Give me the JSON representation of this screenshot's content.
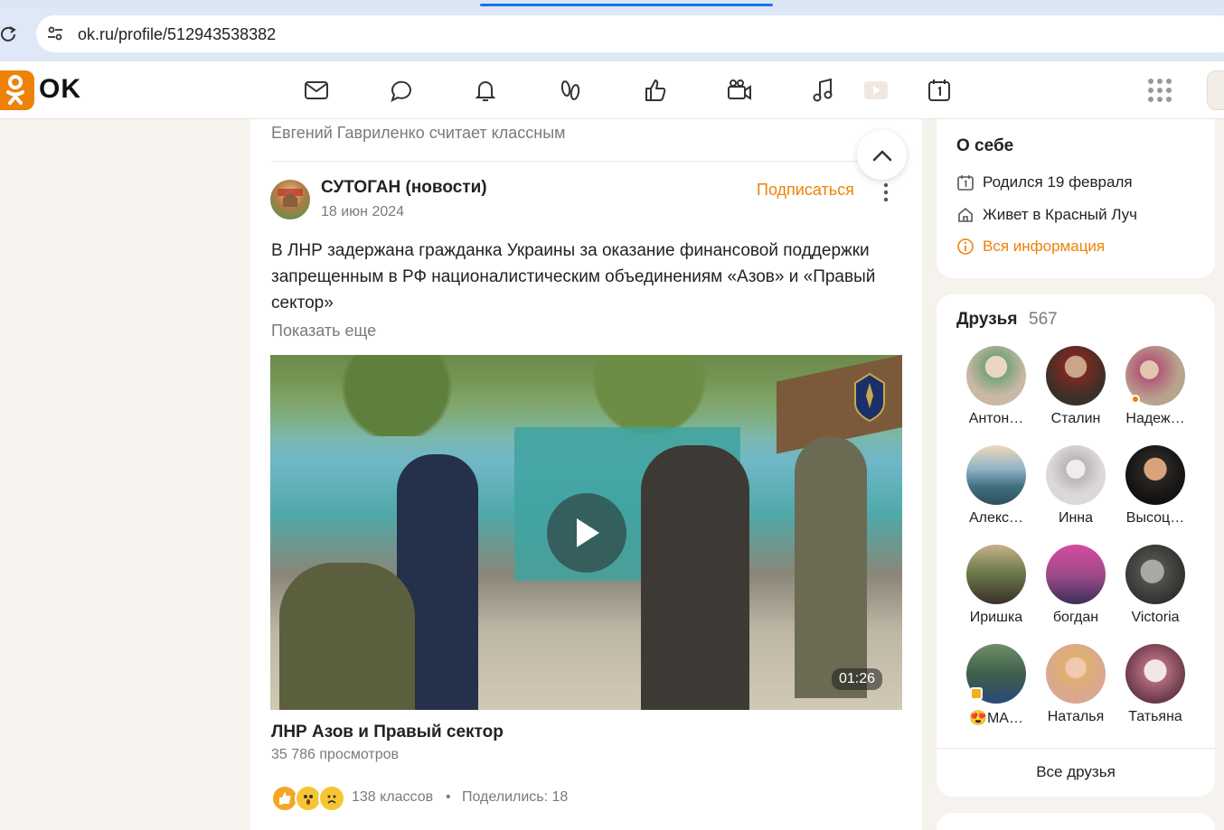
{
  "browser": {
    "url": "ok.ru/profile/512943538382"
  },
  "header": {
    "logo_text": "OK",
    "nav": [
      "messages-icon",
      "discussions-icon",
      "notifications-icon",
      "guests-icon",
      "marks-icon",
      "video-icon",
      "music-icon",
      "play-icon",
      "calendar-icon"
    ],
    "brand_color": "#ee8208"
  },
  "feed": {
    "liker_text": "Евгений Гавриленко считает классным",
    "post": {
      "group_name": "СУТОГАН (новости)",
      "date": "18 июн 2024",
      "subscribe_label": "Подписаться",
      "text": "В ЛНР задержана гражданка Украины за оказание финансовой поддержки запрещенным в РФ националистическим объединениям «Азов» и «Правый сектор»",
      "show_more": "Показать еще",
      "video": {
        "duration": "01:26",
        "title": "ЛНР Азов и Правый сектор",
        "views": "35 786 просмотров"
      },
      "likes": "138 классов",
      "separator": "•",
      "shares": "Поделились: 18"
    }
  },
  "about": {
    "title": "О себе",
    "birthday": "Родился 19 февраля",
    "city": "Живет в Красный Луч",
    "all_info": "Вся информация"
  },
  "friends": {
    "title": "Друзья",
    "count": "567",
    "items": [
      {
        "name": "Антон…",
        "color": "#c9b8a6"
      },
      {
        "name": "Сталин",
        "color": "#5a4a3c"
      },
      {
        "name": "Надеж…",
        "color": "#b8a48e"
      },
      {
        "name": "Алекс…",
        "color": "#6f93a8"
      },
      {
        "name": "Инна",
        "color": "#d9d4d4"
      },
      {
        "name": "Высоц…",
        "color": "#3a3632"
      },
      {
        "name": "Иришка",
        "color": "#a88e72"
      },
      {
        "name": "богдан",
        "color": "#c76aa8"
      },
      {
        "name": "Victoria",
        "color": "#5c5e5a"
      },
      {
        "name": "😍МА…",
        "color": "#4f6b5a"
      },
      {
        "name": "Наталья",
        "color": "#d9a88e"
      },
      {
        "name": "Татьяна",
        "color": "#b06a7a"
      }
    ],
    "all_label": "Все друзья"
  }
}
